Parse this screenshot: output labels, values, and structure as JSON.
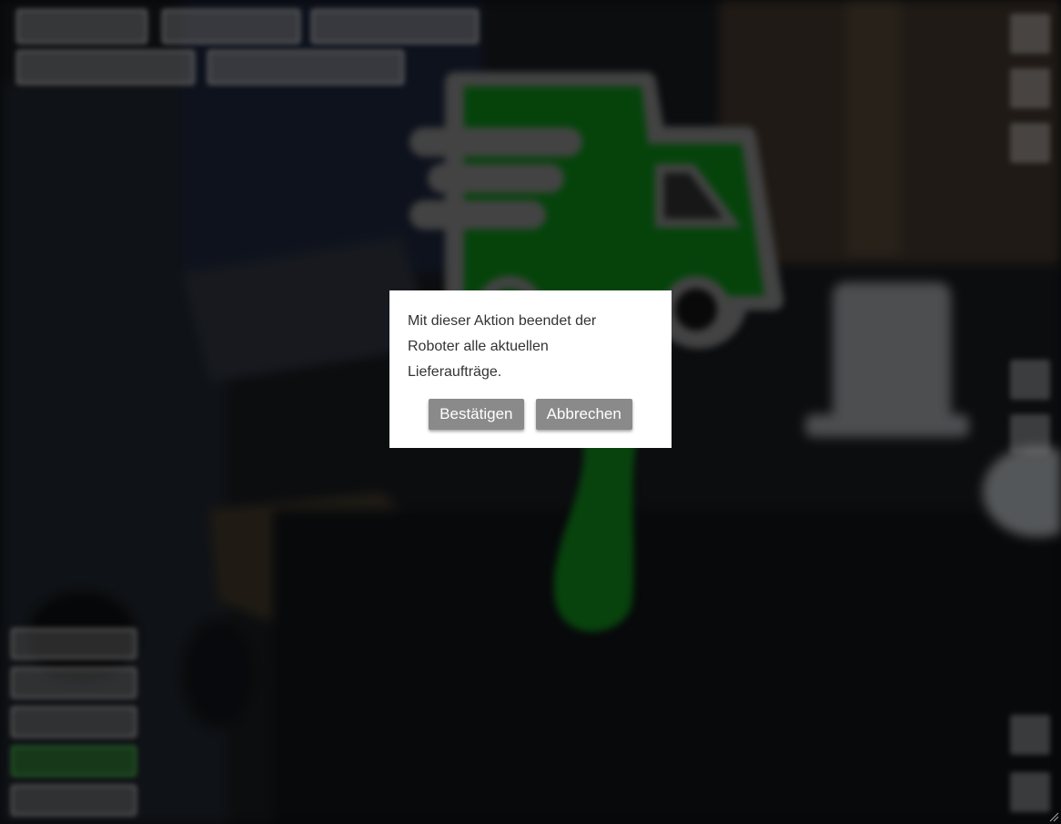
{
  "dialog": {
    "message": "Mit dieser Aktion beendet der Roboter alle aktuellen Lieferaufträge.",
    "confirm_label": "Bestätigen",
    "cancel_label": "Abbrechen"
  },
  "colors": {
    "delivery_icon": "#0a7a14",
    "dialog_button": "#8a8a8a",
    "dialog_background": "#ffffff"
  },
  "icons": {
    "background_overlay": "delivery-truck-icon"
  }
}
